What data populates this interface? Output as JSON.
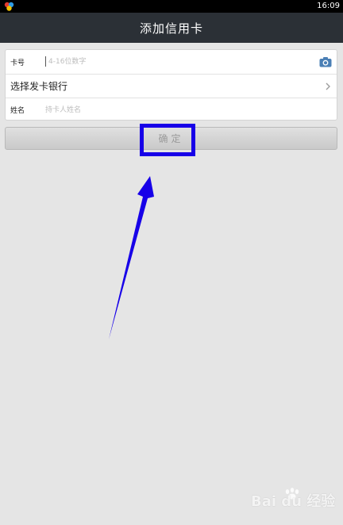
{
  "status_bar": {
    "time": "16:09"
  },
  "title_bar": {
    "title": "添加信用卡"
  },
  "form": {
    "card_number": {
      "label": "卡号",
      "placeholder": "4-16位数字",
      "value": ""
    },
    "bank": {
      "label": "选择发卡银行"
    },
    "name": {
      "label": "姓名",
      "placeholder": "持卡人姓名",
      "value": ""
    }
  },
  "confirm_button": {
    "label": "确定"
  },
  "annotation": {
    "color": "#1700e8"
  },
  "watermark": {
    "text": "Bai du 经验"
  },
  "icons": {
    "status_app": "app-logo-icon",
    "camera": "camera-icon",
    "chevron": "chevron-right-icon"
  },
  "colors": {
    "titlebar": "#2b3036",
    "background": "#e5e5e5"
  }
}
